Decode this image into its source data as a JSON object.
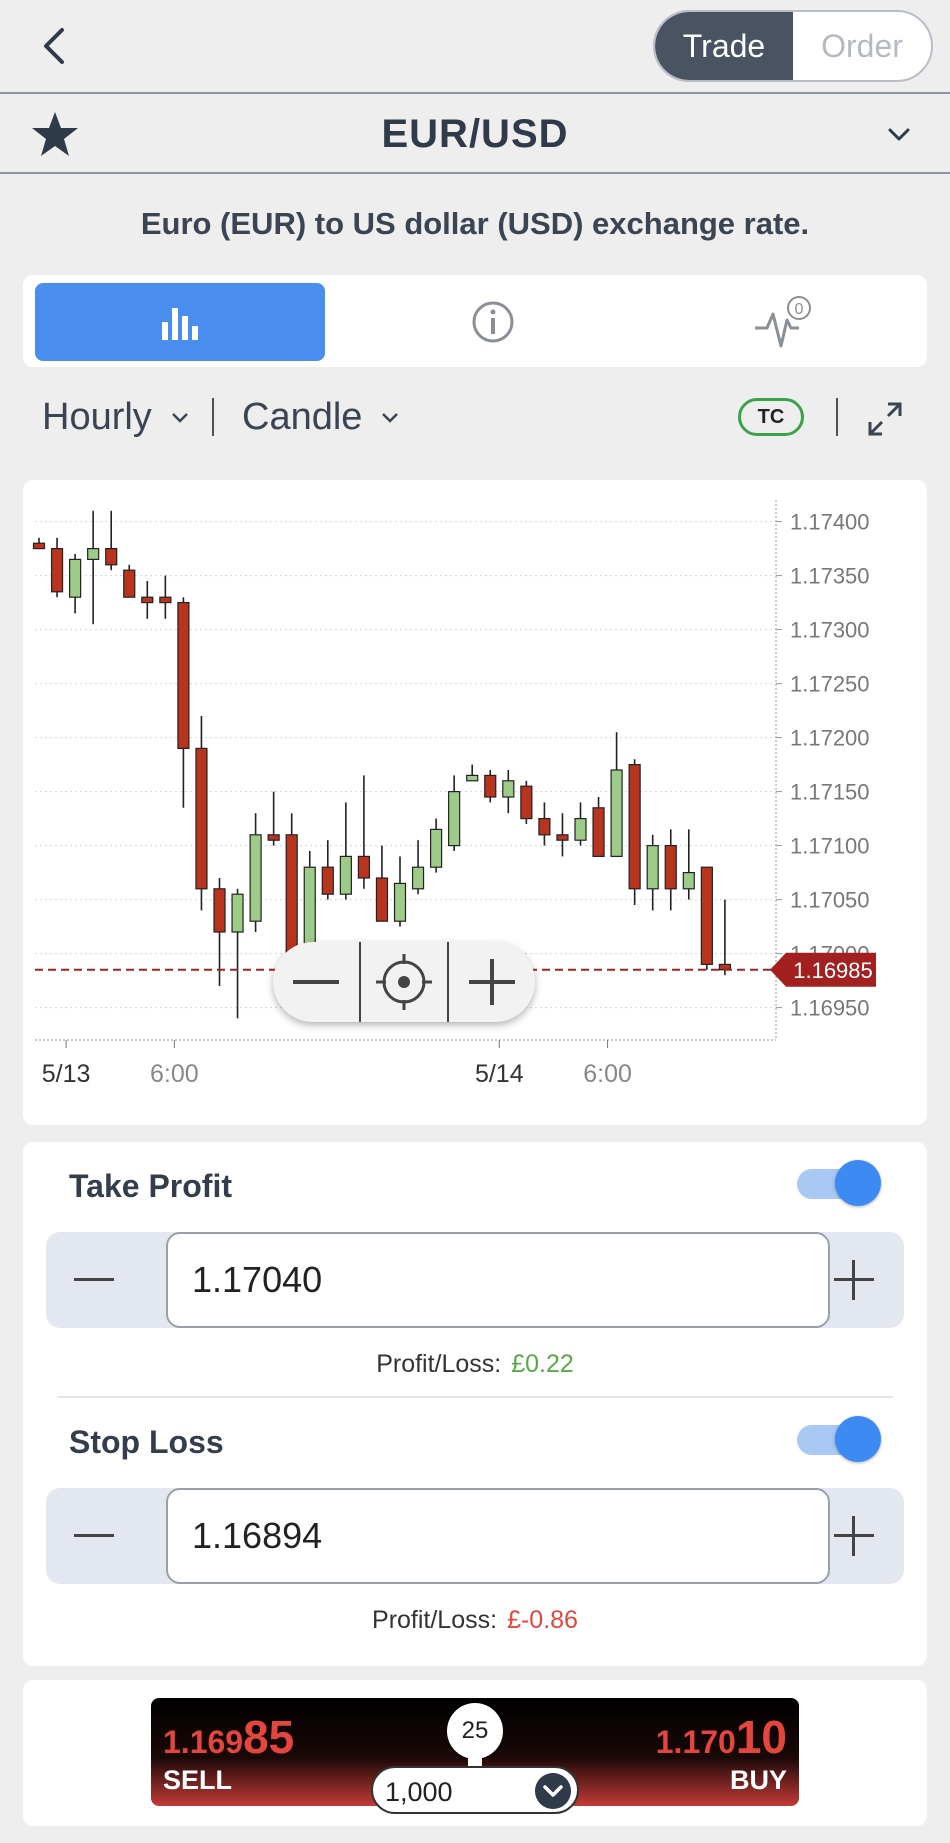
{
  "header": {
    "segments": [
      {
        "label": "Trade"
      },
      {
        "label": "Order"
      }
    ]
  },
  "instrument": {
    "symbol": "EUR/USD",
    "description": "Euro (EUR) to US dollar (USD) exchange rate."
  },
  "tabs": [
    {
      "icon": "bar-chart-icon",
      "active": true
    },
    {
      "icon": "info-icon",
      "active": false
    },
    {
      "icon": "activity-icon",
      "badge": "0",
      "active": false
    }
  ],
  "controls": {
    "timeframe": "Hourly",
    "chart_type": "Candle",
    "tc_label": "TC"
  },
  "chart_data": {
    "type": "candlestick",
    "ylim": [
      1.1692,
      1.1742
    ],
    "y_ticks": [
      "1.17400",
      "1.17350",
      "1.17300",
      "1.17250",
      "1.17200",
      "1.17150",
      "1.17100",
      "1.17050",
      "1.17000",
      "1.16950"
    ],
    "x_ticks": [
      {
        "label": "5/13",
        "index": 1.5,
        "muted": false
      },
      {
        "label": "6:00",
        "index": 7.5,
        "muted": true
      },
      {
        "label": "5/14",
        "index": 25.5,
        "muted": false
      },
      {
        "label": "6:00",
        "index": 31.5,
        "muted": true
      }
    ],
    "current_price": "1.16985",
    "current_price_value": 1.16985,
    "candles": [
      {
        "o": 1.1738,
        "h": 1.17385,
        "l": 1.17375,
        "c": 1.17375
      },
      {
        "o": 1.17375,
        "h": 1.17385,
        "l": 1.1733,
        "c": 1.17335
      },
      {
        "o": 1.1733,
        "h": 1.1737,
        "l": 1.17315,
        "c": 1.17365
      },
      {
        "o": 1.17365,
        "h": 1.1741,
        "l": 1.17305,
        "c": 1.17375
      },
      {
        "o": 1.17375,
        "h": 1.1741,
        "l": 1.17355,
        "c": 1.1736
      },
      {
        "o": 1.17355,
        "h": 1.1736,
        "l": 1.1733,
        "c": 1.1733
      },
      {
        "o": 1.1733,
        "h": 1.17345,
        "l": 1.1731,
        "c": 1.17325
      },
      {
        "o": 1.1733,
        "h": 1.1735,
        "l": 1.1731,
        "c": 1.17325
      },
      {
        "o": 1.17325,
        "h": 1.1733,
        "l": 1.17135,
        "c": 1.1719
      },
      {
        "o": 1.1719,
        "h": 1.1722,
        "l": 1.1704,
        "c": 1.1706
      },
      {
        "o": 1.1706,
        "h": 1.1707,
        "l": 1.1697,
        "c": 1.1702
      },
      {
        "o": 1.1702,
        "h": 1.1706,
        "l": 1.1694,
        "c": 1.17055
      },
      {
        "o": 1.1703,
        "h": 1.1713,
        "l": 1.1702,
        "c": 1.1711
      },
      {
        "o": 1.1711,
        "h": 1.1715,
        "l": 1.171,
        "c": 1.17105
      },
      {
        "o": 1.1711,
        "h": 1.1713,
        "l": 1.17,
        "c": 1.17
      },
      {
        "o": 1.17,
        "h": 1.17095,
        "l": 1.1699,
        "c": 1.1708
      },
      {
        "o": 1.1708,
        "h": 1.17105,
        "l": 1.1705,
        "c": 1.17055
      },
      {
        "o": 1.17055,
        "h": 1.1714,
        "l": 1.1705,
        "c": 1.1709
      },
      {
        "o": 1.1709,
        "h": 1.17165,
        "l": 1.1706,
        "c": 1.1707
      },
      {
        "o": 1.1707,
        "h": 1.171,
        "l": 1.1703,
        "c": 1.1703
      },
      {
        "o": 1.1703,
        "h": 1.1709,
        "l": 1.17025,
        "c": 1.17065
      },
      {
        "o": 1.1706,
        "h": 1.17105,
        "l": 1.17055,
        "c": 1.1708
      },
      {
        "o": 1.1708,
        "h": 1.17125,
        "l": 1.17075,
        "c": 1.17115
      },
      {
        "o": 1.171,
        "h": 1.17165,
        "l": 1.17095,
        "c": 1.1715
      },
      {
        "o": 1.1716,
        "h": 1.17175,
        "l": 1.1716,
        "c": 1.17165
      },
      {
        "o": 1.17165,
        "h": 1.1717,
        "l": 1.1714,
        "c": 1.17145
      },
      {
        "o": 1.17145,
        "h": 1.1717,
        "l": 1.1713,
        "c": 1.1716
      },
      {
        "o": 1.17155,
        "h": 1.1716,
        "l": 1.1712,
        "c": 1.17125
      },
      {
        "o": 1.17125,
        "h": 1.1714,
        "l": 1.171,
        "c": 1.1711
      },
      {
        "o": 1.1711,
        "h": 1.1713,
        "l": 1.1709,
        "c": 1.17105
      },
      {
        "o": 1.17105,
        "h": 1.1714,
        "l": 1.171,
        "c": 1.17125
      },
      {
        "o": 1.17135,
        "h": 1.17145,
        "l": 1.1709,
        "c": 1.1709
      },
      {
        "o": 1.1709,
        "h": 1.17205,
        "l": 1.1709,
        "c": 1.1717
      },
      {
        "o": 1.17175,
        "h": 1.1718,
        "l": 1.17045,
        "c": 1.1706
      },
      {
        "o": 1.1706,
        "h": 1.1711,
        "l": 1.1704,
        "c": 1.171
      },
      {
        "o": 1.171,
        "h": 1.17115,
        "l": 1.1704,
        "c": 1.1706
      },
      {
        "o": 1.1706,
        "h": 1.17115,
        "l": 1.1705,
        "c": 1.17075
      },
      {
        "o": 1.1708,
        "h": 1.1708,
        "l": 1.16985,
        "c": 1.1699
      },
      {
        "o": 1.1699,
        "h": 1.1705,
        "l": 1.1698,
        "c": 1.16985
      }
    ],
    "colors": {
      "up": "#9dcb88",
      "down": "#b8341f",
      "price_line": "#a32020"
    }
  },
  "take_profit": {
    "label": "Take Profit",
    "enabled": true,
    "value": "1.17040",
    "pl_label": "Profit/Loss:",
    "pl_value": "£0.22"
  },
  "stop_loss": {
    "label": "Stop Loss",
    "enabled": true,
    "value": "1.16894",
    "pl_label": "Profit/Loss:",
    "pl_value": "£-0.86"
  },
  "trade": {
    "sell_price_prefix": "1.169",
    "sell_price_big": "85",
    "sell_label": "SELL",
    "buy_price_prefix": "1.170",
    "buy_price_big": "10",
    "buy_label": "BUY",
    "leverage": "25",
    "amount": "1,000"
  },
  "colors": {
    "accent": "#4a8ff0",
    "header_dark": "#495362",
    "positive": "#5aa84a",
    "negative": "#e2463d"
  }
}
